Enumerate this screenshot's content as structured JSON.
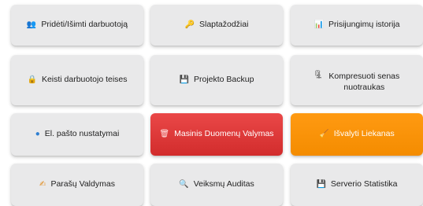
{
  "tiles": [
    {
      "label": "Pridėti/Išimti darbuotoją",
      "icon": "people-icon",
      "glyph": "👥"
    },
    {
      "label": "Slaptažodžiai",
      "icon": "key-icon",
      "glyph": "🔑"
    },
    {
      "label": "Prisijungimų istorija",
      "icon": "bar-chart-icon",
      "glyph": "📊"
    },
    {
      "label": "Keisti darbuotojo teises",
      "icon": "lock-icon",
      "glyph": "🔒"
    },
    {
      "label": "Projekto Backup",
      "icon": "floppy-disk-icon",
      "glyph": "💾"
    },
    {
      "label": "Kompresuoti senas nuotraukas",
      "icon": "clamp-icon",
      "glyph": "🗜"
    },
    {
      "label": "El. pašto nustatymai",
      "icon": "email-icon",
      "glyph": "●"
    },
    {
      "label": "Masinis Duomenų Valymas",
      "icon": "trash-icon",
      "glyph": "🗑"
    },
    {
      "label": "Išvalyti Liekanas",
      "icon": "broom-icon",
      "glyph": "🧹"
    },
    {
      "label": "Parašų Valdymas",
      "icon": "writing-hand-icon",
      "glyph": "✍"
    },
    {
      "label": "Veiksmų Auditas",
      "icon": "magnifier-icon",
      "glyph": "🔍"
    },
    {
      "label": "Serverio Statistika",
      "icon": "floppy-disk-icon",
      "glyph": "💾"
    }
  ],
  "colors": {
    "tile_bg": "#e9e9ea",
    "danger": "#de3b3b",
    "warning": "#f7900a"
  }
}
